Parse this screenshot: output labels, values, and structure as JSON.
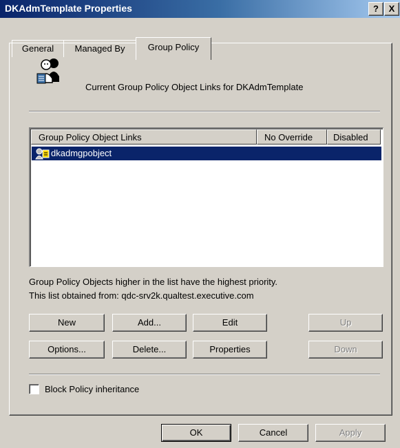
{
  "window": {
    "title": "DKAdmTemplate Properties",
    "help_btn": "?",
    "close_btn": "X"
  },
  "tabs": [
    {
      "label": "General",
      "active": false
    },
    {
      "label": "Managed By",
      "active": false
    },
    {
      "label": "Group Policy",
      "active": true
    }
  ],
  "header": {
    "icon": "group-users-icon",
    "text": "Current Group Policy Object Links for DKAdmTemplate"
  },
  "list": {
    "columns": [
      "Group Policy Object Links",
      "No Override",
      "Disabled"
    ],
    "rows": [
      {
        "icon": "group-policy-object-icon",
        "name": "dkadmgpobject",
        "selected": true
      }
    ]
  },
  "info": {
    "line1": "Group Policy Objects higher in the list have the highest priority.",
    "line2": "This list obtained from: qdc-srv2k.qualtest.executive.com"
  },
  "buttons": {
    "new": "New",
    "add": "Add...",
    "edit": "Edit",
    "up": "Up",
    "options": "Options...",
    "delete": "Delete...",
    "properties": "Properties",
    "down": "Down"
  },
  "checkbox": {
    "label": "Block Policy inheritance",
    "checked": false
  },
  "footer": {
    "ok": "OK",
    "cancel": "Cancel",
    "apply": "Apply"
  },
  "colors": {
    "face": "#d4d0c8",
    "titlebar_start": "#0a246a",
    "titlebar_end": "#a6caf0",
    "selection": "#0a246a",
    "disabled_text": "#808080"
  }
}
